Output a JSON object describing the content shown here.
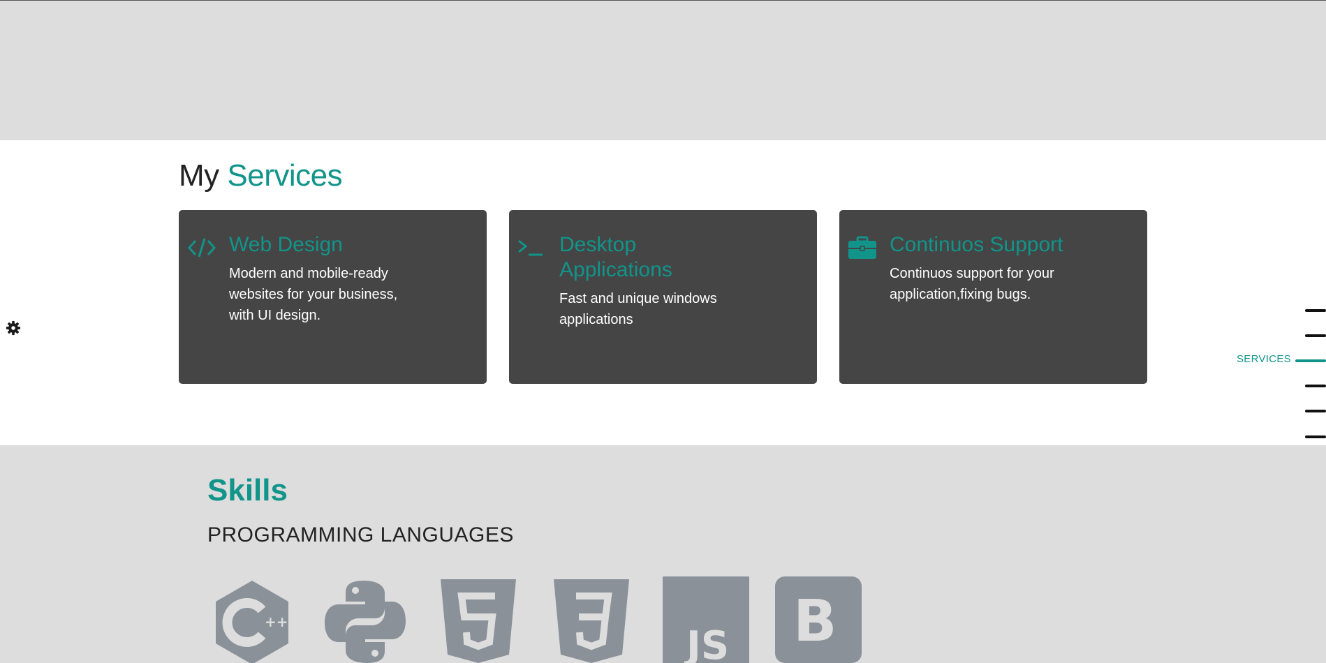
{
  "services": {
    "title_plain": "My",
    "title_accent": "Services",
    "cards": [
      {
        "icon": "code-icon",
        "title": "Web Design",
        "description": "Modern and mobile-ready websites for your business, with UI design."
      },
      {
        "icon": "terminal-icon",
        "title": "Desktop Applications",
        "description": "Fast and unique windows applications"
      },
      {
        "icon": "briefcase-icon",
        "title": "Continuos Support",
        "description": "Continuos support for your application,fixing bugs."
      }
    ]
  },
  "side_nav": {
    "active_label": "SERVICES"
  },
  "skills": {
    "title": "Skills",
    "subtitle": "PROGRAMMING LANGUAGES",
    "logos": [
      "cplusplus-icon",
      "python-icon",
      "html5-icon",
      "css3-icon",
      "javascript-icon",
      "bootstrap-icon"
    ]
  },
  "colors": {
    "accent": "#11948a",
    "card_bg": "#454545",
    "page_bg": "#dddddd",
    "logo_gray": "#8a9199"
  }
}
